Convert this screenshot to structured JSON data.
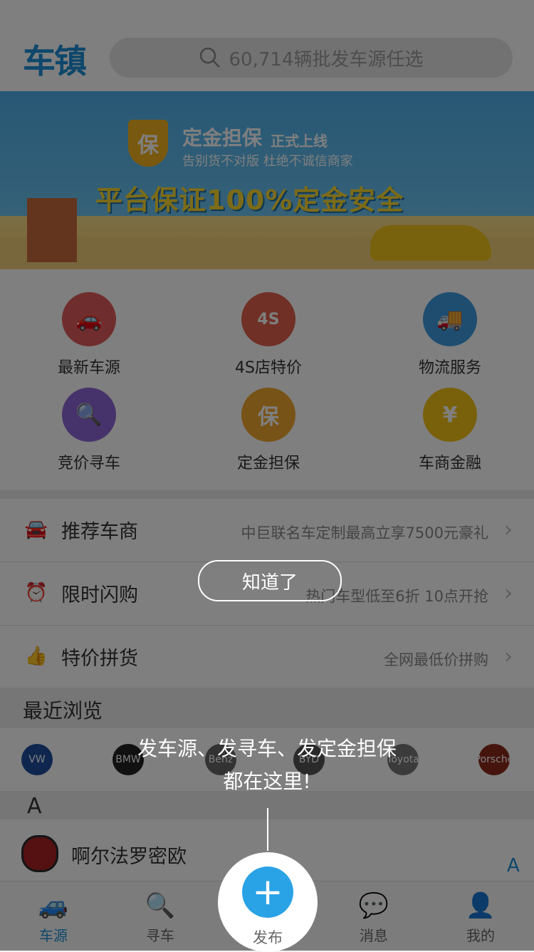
{
  "header": {
    "logo": "车镇",
    "search_placeholder": "60,714辆批发车源任选"
  },
  "banner": {
    "badge": "保",
    "title": "定金担保",
    "title_suffix": "正式上线",
    "subtitle": "告别货不对版  杜绝不诚信商家",
    "headline": "平台保证100%定金安全"
  },
  "grid": [
    {
      "label": "最新车源",
      "icon": "car-icon",
      "color": "#e05a5a",
      "glyph": "🚗"
    },
    {
      "label": "4S店特价",
      "icon": "4s-car-icon",
      "color": "#e0604c",
      "glyph": "4S"
    },
    {
      "label": "物流服务",
      "icon": "truck-icon",
      "color": "#3d9ae0",
      "glyph": "🚚"
    },
    {
      "label": "竞价寻车",
      "icon": "car-search-icon",
      "color": "#8e67d6",
      "glyph": "🔍"
    },
    {
      "label": "定金担保",
      "icon": "shield-icon",
      "color": "#f0a62e",
      "glyph": "保"
    },
    {
      "label": "车商金融",
      "icon": "yen-icon",
      "color": "#f2c318",
      "glyph": "¥"
    }
  ],
  "list": [
    {
      "title": "推荐车商",
      "sub": "中巨联名车定制最高立享7500元豪礼",
      "icon": "4s-car-icon",
      "glyph": "🚘",
      "color": "#f2a63a"
    },
    {
      "title": "限时闪购",
      "sub": "热门车型低至6折 10点开抢",
      "icon": "alarm-clock-icon",
      "glyph": "⏰",
      "color": "#e04848"
    },
    {
      "title": "特价拼货",
      "sub": "全网最低价拼购",
      "icon": "thumbs-up-icon",
      "glyph": "👍",
      "color": "#e0407a"
    }
  ],
  "recent": {
    "title": "最近浏览",
    "brands": [
      "VW",
      "BMW",
      "Benz",
      "BYD",
      "Toyota",
      "Porsche"
    ]
  },
  "section_letter": "A",
  "brand_item": {
    "name": "啊尔法罗密欧"
  },
  "index_letter": "A",
  "tabs": [
    {
      "label": "车源",
      "icon": "car-icon",
      "glyph": "🚙",
      "active": true
    },
    {
      "label": "寻车",
      "icon": "car-search-icon",
      "glyph": "🔍",
      "active": false
    },
    {
      "label": "发布",
      "icon": "plus-icon",
      "glyph": "+",
      "active": false
    },
    {
      "label": "消息",
      "icon": "chat-icon",
      "glyph": "💬",
      "active": false
    },
    {
      "label": "我的",
      "icon": "user-icon",
      "glyph": "👤",
      "active": false
    }
  ],
  "overlay": {
    "hint_line1": "发车源、发寻车、发定金担保",
    "hint_line2": "都在这里!",
    "dismiss_label": "知道了",
    "publish_label": "发布"
  }
}
